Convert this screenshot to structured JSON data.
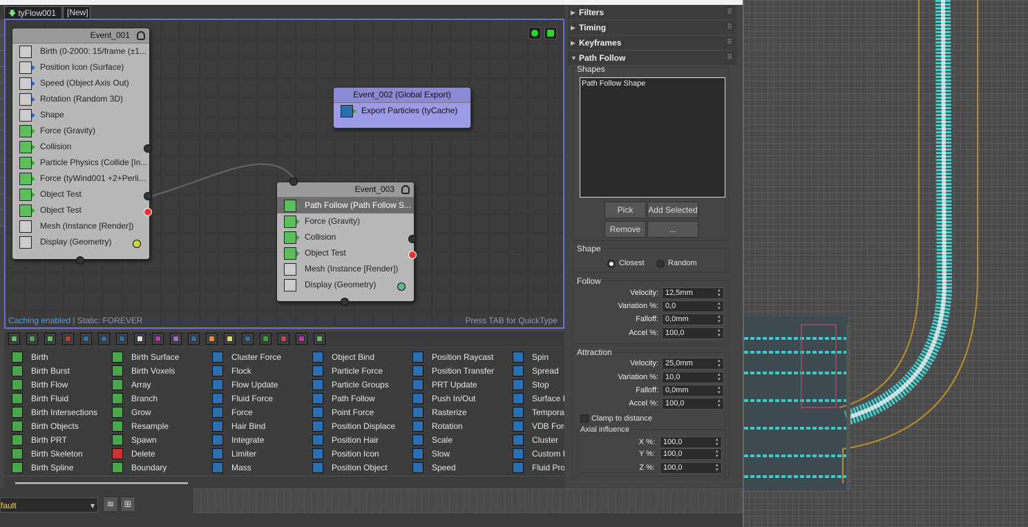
{
  "tabs": {
    "active": "tyFlow001",
    "new": "[New]"
  },
  "event1": {
    "title": "Event_001",
    "operators": [
      "Birth (0-2000: 15/frame (±1...",
      "Position Icon (Surface)",
      "Speed (Object Axis Out)",
      "Rotation (Random 3D)",
      "Shape",
      "Force (Gravity)",
      "Collision",
      "Particle Physics (Collide [In...",
      "Force (tyWind001 +2+Perli...",
      "Object Test",
      "Object Test",
      "Mesh (Instance [Render])",
      "Display (Geometry)"
    ]
  },
  "event2": {
    "title": "Event_002 (Global Export)",
    "operators": [
      "Export Particles (tyCache)"
    ]
  },
  "event3": {
    "title": "Event_003",
    "operators": [
      "Path Follow (Path Follow S...",
      "Force (Gravity)",
      "Collision",
      "Object Test",
      "Mesh (Instance [Render])",
      "Display (Geometry)"
    ]
  },
  "graph": {
    "caching": "Caching enabled",
    "static": " | Static: FOREVER",
    "hint": "Press TAB for QuickType"
  },
  "palette": {
    "col1": [
      "Birth",
      "Birth Burst",
      "Birth Flow",
      "Birth Fluid",
      "Birth Intersections",
      "Birth Objects",
      "Birth PRT",
      "Birth Skeleton",
      "Birth Spline"
    ],
    "col2": [
      "Birth Surface",
      "Birth Voxels",
      "Array",
      "Branch",
      "Grow",
      "Resample",
      "Spawn",
      "Delete",
      "Boundary"
    ],
    "col3": [
      "Cluster Force",
      "Flock",
      "Flow Update",
      "Fluid Force",
      "Force",
      "Hair Bind",
      "Integrate",
      "Limiter",
      "Mass"
    ],
    "col4": [
      "Object Bind",
      "Particle Force",
      "Particle Groups",
      "Path Follow",
      "Point Force",
      "Position Displace",
      "Position Hair",
      "Position Icon",
      "Position Object"
    ],
    "col5": [
      "Position Raycast",
      "Position Transfer",
      "PRT Update",
      "Push In/Out",
      "Rasterize",
      "Rotation",
      "Scale",
      "Slow",
      "Speed"
    ],
    "col6": [
      "Spin",
      "Spread",
      "Stop",
      "Surface F",
      "Temporal",
      "VDB Forc",
      "Cluster",
      "Custom P",
      "Fluid Prop"
    ]
  },
  "panel": {
    "rollups": [
      "Filters",
      "Timing",
      "Keyframes",
      "Path Follow"
    ],
    "shapes_label": "Shapes",
    "shapes_list": [
      "Path Follow Shape"
    ],
    "buttons": {
      "pick": "Pick",
      "add_selected": "Add Selected",
      "remove": "Remove",
      "more": "..."
    },
    "shape_group": "Shape",
    "shape_options": {
      "closest": "Closest",
      "random": "Random",
      "selected": "Closest"
    },
    "follow": {
      "title": "Follow",
      "velocity_label": "Velocity:",
      "velocity": "12,5mm",
      "variation_label": "Variation %:",
      "variation": "0,0",
      "falloff_label": "Falloff:",
      "falloff": "0,0mm",
      "accel_label": "Accel %:",
      "accel": "100,0"
    },
    "attraction": {
      "title": "Attraction",
      "velocity_label": "Velocity:",
      "velocity": "25,0mm",
      "variation_label": "Variation %:",
      "variation": "10,0",
      "falloff_label": "Falloff:",
      "falloff": "0,0mm",
      "accel_label": "Accel %:",
      "accel": "100,0",
      "clamp_label": "Clamp to distance"
    },
    "axial": {
      "title": "Axial influence",
      "x_label": "X %:",
      "x": "100,0",
      "y_label": "Y %:",
      "y": "100,0",
      "z_label": "Z %:",
      "z": "100,0"
    }
  },
  "bottom": {
    "layer": "fault"
  },
  "colors": {
    "graph_border": "#6f6fd8",
    "event2_bg": "#9c9ce6",
    "caching_text": "#5b9bd5",
    "operator_green": "#5bbf5b",
    "particle_cyan": "#3ee8e8"
  }
}
